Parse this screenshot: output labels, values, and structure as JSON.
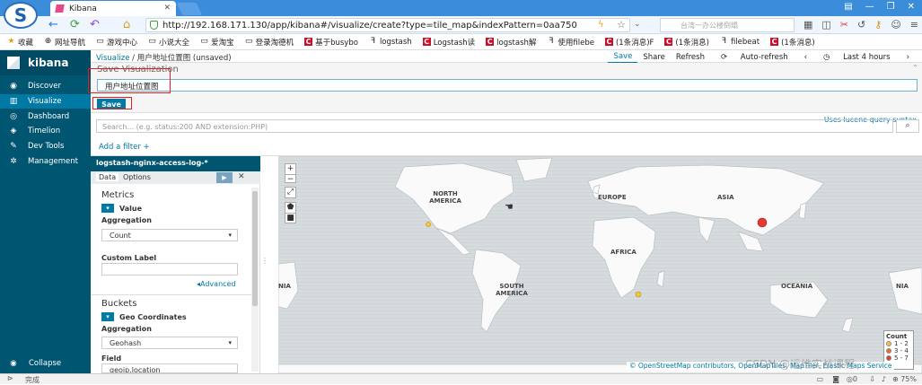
{
  "browser": {
    "tab_title": "Kibana",
    "url": "http://192.168.171.130/app/kibana#/visualize/create?type=tile_map&indexPattern=0aa750",
    "search_placeholder": "台湾一办公楼倒塌",
    "status_text": "完成",
    "zoom": "75%",
    "status_count": "0"
  },
  "bookmarks": [
    {
      "label": "收藏",
      "icon": "star-icon"
    },
    {
      "label": "网址导航",
      "icon": "globe-icon"
    },
    {
      "label": "游戏中心",
      "icon": "folder-icon"
    },
    {
      "label": "小说大全",
      "icon": "folder-icon"
    },
    {
      "label": "爱淘宝",
      "icon": "folder-icon"
    },
    {
      "label": "登录淘德机",
      "icon": "folder-icon"
    },
    {
      "label": "基于busybo",
      "icon": "csdn-icon"
    },
    {
      "label": "logstash",
      "icon": "elastic-icon"
    },
    {
      "label": "Logstash读",
      "icon": "csdn-icon"
    },
    {
      "label": "logstash解",
      "icon": "csdn-icon"
    },
    {
      "label": "使用filebe",
      "icon": "elastic-icon"
    },
    {
      "label": "(1条消息)F",
      "icon": "csdn-icon"
    },
    {
      "label": "(1条消息)",
      "icon": "csdn-icon"
    },
    {
      "label": "filebeat",
      "icon": "elastic-icon"
    },
    {
      "label": "(1条消息)",
      "icon": "csdn-icon"
    }
  ],
  "sidebar": {
    "brand": "kibana",
    "items": [
      {
        "label": "Discover",
        "icon": "compass-icon"
      },
      {
        "label": "Visualize",
        "icon": "bar-chart-icon"
      },
      {
        "label": "Dashboard",
        "icon": "dashboard-icon"
      },
      {
        "label": "Timelion",
        "icon": "shield-icon"
      },
      {
        "label": "Dev Tools",
        "icon": "wrench-icon"
      },
      {
        "label": "Management",
        "icon": "gear-icon"
      }
    ],
    "collapse": "Collapse"
  },
  "header": {
    "breadcrumb_root": "Visualize",
    "breadcrumb_current": "用户地址位置图 (unsaved)",
    "menu": {
      "save": "Save",
      "share": "Share",
      "refresh": "Refresh",
      "auto_refresh": "Auto-refresh",
      "time": "Last 4 hours"
    }
  },
  "save_panel": {
    "title": "Save Visualization",
    "input_value": "用户地址位置图",
    "button": "Save"
  },
  "query": {
    "placeholder": "Search... (e.g. status:200 AND extension:PHP)",
    "syntax_link": "Uses lucene query syntax",
    "add_filter": "Add a filter"
  },
  "editor": {
    "index_pattern": "logstash-nginx-access-log-*",
    "tabs": [
      "Data",
      "Options"
    ],
    "metrics_title": "Metrics",
    "metric_label": "Value",
    "aggregation_label": "Aggregation",
    "aggregation_value": "Count",
    "custom_label": "Custom Label",
    "advanced": "Advanced",
    "buckets_title": "Buckets",
    "bucket_label": "Geo Coordinates",
    "bucket_aggregation_label": "Aggregation",
    "bucket_aggregation_value": "Geohash",
    "field_label": "Field",
    "field_value": "geoip.location"
  },
  "map": {
    "labels": [
      "NORTH AMERICA",
      "EUROPE",
      "ASIA",
      "AFRICA",
      "SOUTH AMERICA",
      "OCEANIA",
      "NIA",
      "NIA"
    ],
    "legend_title": "Count",
    "legend": [
      {
        "range": "1 - 2",
        "color": "#f5c542"
      },
      {
        "range": "3 - 4",
        "color": "#e8702a"
      },
      {
        "range": "5 - 7",
        "color": "#e03c31"
      }
    ],
    "attribution": "© OpenStreetMap contributors, OpenMapTiles, MapTiler, Elastic Maps Service",
    "watermark": "CSDN @运维实战课程"
  }
}
